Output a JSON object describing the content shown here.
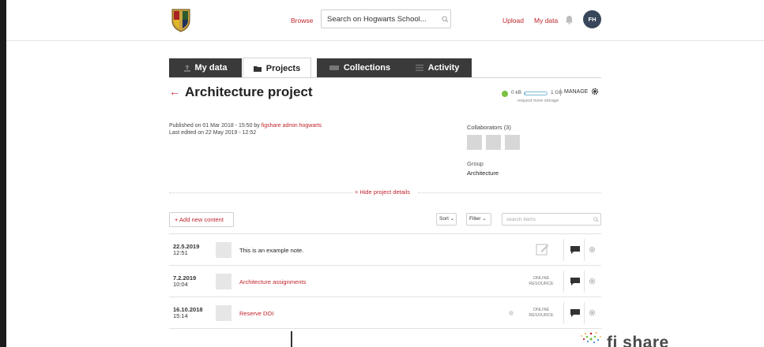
{
  "header": {
    "browse_label": "Browse",
    "search_value": "Search on Hogwarts School...",
    "upload_label": "Upload",
    "mydata_label": "My data",
    "avatar_initials": "FH"
  },
  "tabs": [
    {
      "label": "My data",
      "icon": "upload-icon"
    },
    {
      "label": "Projects",
      "icon": "folder-icon",
      "active": true
    },
    {
      "label": "Collections",
      "icon": "collection-icon"
    },
    {
      "label": "Activity",
      "icon": "activity-icon"
    }
  ],
  "project": {
    "back_arrow": "←",
    "title": "Architecture project",
    "storage": {
      "used": "0 kB",
      "total": "1 GB",
      "more": "request more storage",
      "fill_fraction": 0.05,
      "status_color": "#7ac143"
    },
    "manage_label": "MANAGE",
    "published_prefix": "Published on 01 Mar 2018 - 15:50 by ",
    "published_by": "figshare admin hogwarts",
    "last_edited": "Last edited on 22 May 2019 - 12:52",
    "collaborators_label": "Collaborators (3)",
    "group_label": "Group",
    "group_value": "Architecture",
    "hide_details_label": "≈ Hide project details"
  },
  "toolbar": {
    "add_label": "+ Add new content",
    "sort_label": "Sort ⌄",
    "filter_label": "Filter ⌄",
    "search_placeholder": "search items"
  },
  "items": [
    {
      "date": "22.5.2019",
      "time": "12:51",
      "title": "This is an example note.",
      "kind": "note"
    },
    {
      "date": "7.2.2019",
      "time": "10:04",
      "title": "Architecture assignments",
      "kind": "online-resource",
      "resource_label_1": "ONLINE",
      "resource_label_2": "RESOURCE"
    },
    {
      "date": "16.10.2018",
      "time": "15:14",
      "title": "Reserve DOI",
      "kind": "online-resource",
      "resource_label_1": "ONLINE",
      "resource_label_2": "RESOURCE"
    }
  ],
  "footer": {
    "brand_text": "fi  share"
  },
  "colors": {
    "accent": "#c0242c",
    "dark_tab": "#3a3a3a",
    "avatar": "#37465a"
  }
}
